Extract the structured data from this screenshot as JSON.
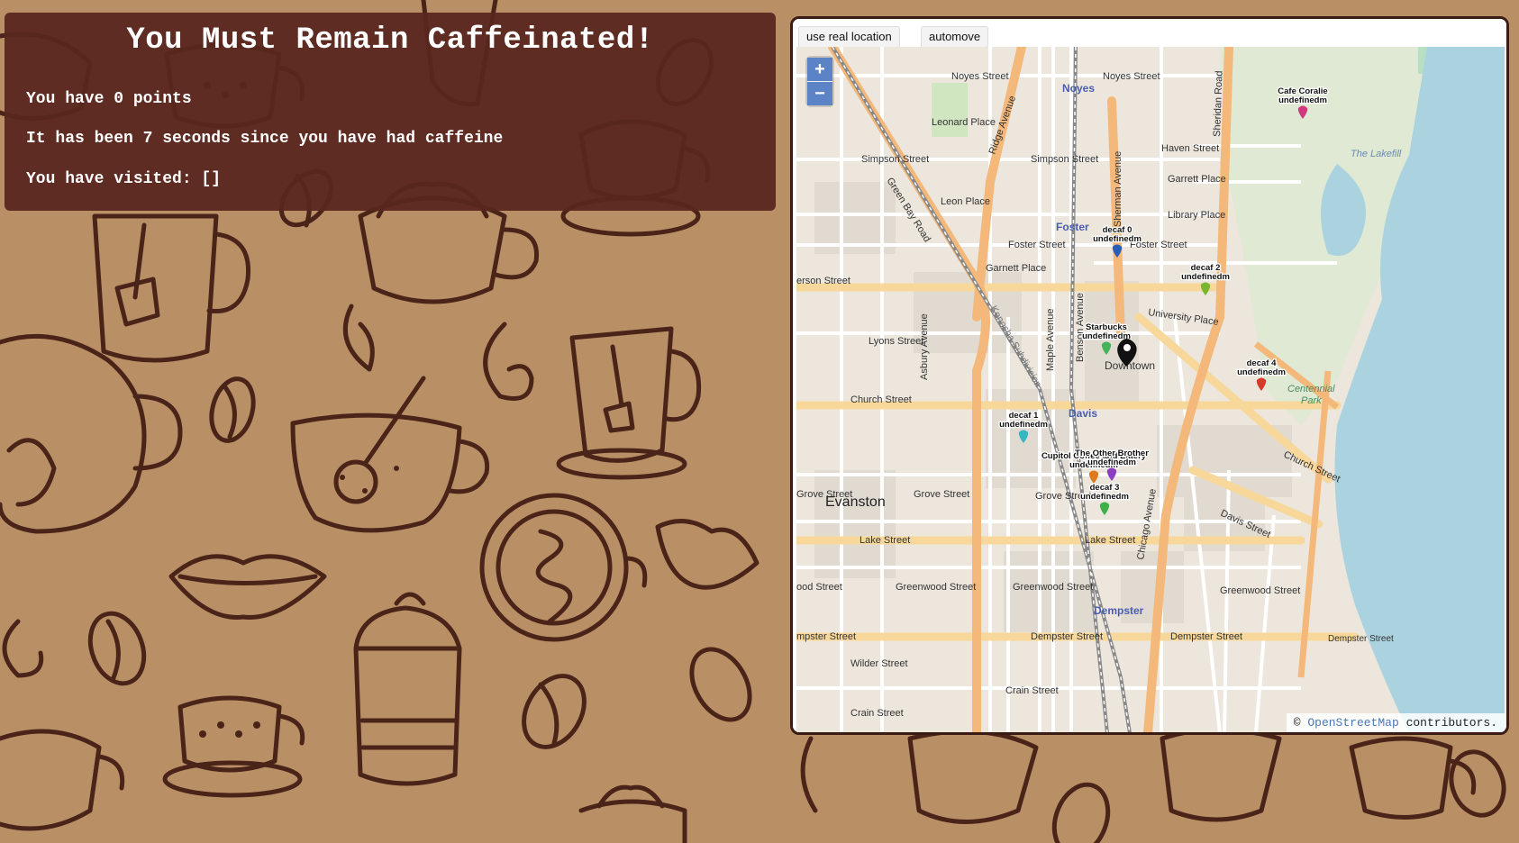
{
  "header": {
    "title": "You Must Remain Caffeinated!",
    "points_text": "You have 0 points",
    "time_text": "It has been 7 seconds since you have had caffeine",
    "visited_text": "You have visited: []"
  },
  "controls": {
    "real_location": "use real location",
    "automove": "automove",
    "zoom_in": "+",
    "zoom_out": "−"
  },
  "map": {
    "attribution_prefix": "©",
    "attribution_link": "OpenStreetMap",
    "attribution_suffix": "contributors.",
    "places": [
      "Evanston",
      "Downtown",
      "Noyes",
      "Foster",
      "Davis",
      "Dempster",
      "The Lakefill",
      "Centennial Park"
    ],
    "streets": [
      "Noyes Street",
      "Simpson Street",
      "Foster Street",
      "Church Street",
      "Grove Street",
      "Lake Street",
      "Dempster Street",
      "Greenwood Street",
      "Green Bay Road",
      "Sheridan Road",
      "Chicago Avenue",
      "Asbury Avenue",
      "Maple Avenue",
      "Davis Street"
    ],
    "markers": [
      {
        "label": "Cafe Coralie",
        "sub": "undefinedm",
        "color": "#d1397f"
      },
      {
        "label": "decaf 0",
        "sub": "undefinedm",
        "color": "#2a5fb8"
      },
      {
        "label": "decaf 2",
        "sub": "undefinedm",
        "color": "#79b52e"
      },
      {
        "label": "Starbucks",
        "sub": "undefinedm",
        "color": "#44b35a"
      },
      {
        "label": "decaf 4",
        "sub": "undefinedm",
        "color": "#d73a2a"
      },
      {
        "label": "decaf 1",
        "sub": "undefinedm",
        "color": "#35b6c3"
      },
      {
        "label": "Cupitol Coffee and Eatery",
        "sub": "undefinedm",
        "color": "#e07b1d"
      },
      {
        "label": "The Other Brother",
        "sub": "undefinedm",
        "color": "#8a3fc0"
      },
      {
        "label": "decaf 3",
        "sub": "undefinedm",
        "color": "#3db04a"
      }
    ]
  },
  "colors": {
    "background": "#b98f66",
    "panel": "#58261e",
    "doodle_stroke": "#4a2418",
    "water": "#aad3df",
    "major_road": "#f7d89a",
    "minor_road": "#ffffff",
    "rail": "#888888"
  }
}
